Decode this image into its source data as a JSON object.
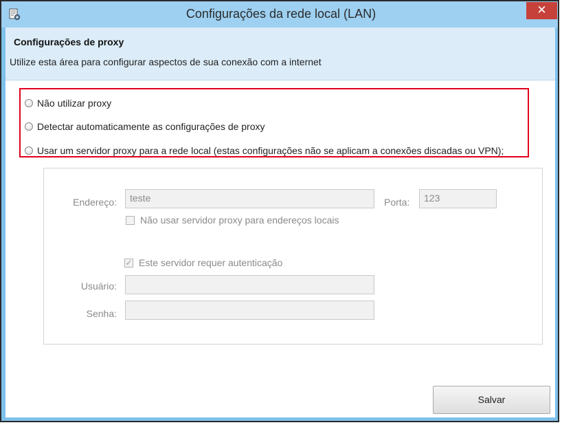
{
  "window": {
    "title": "Configurações da rede local (LAN)",
    "close_glyph": "✕",
    "app_icon": "settings-document-icon"
  },
  "header": {
    "title": "Configurações de proxy",
    "description": "Utilize esta área para configurar aspectos de sua conexão com a internet"
  },
  "proxy_options": [
    {
      "label": "Não utilizar proxy",
      "selected": false
    },
    {
      "label": "Detectar automaticamente as configurações de proxy",
      "selected": false
    },
    {
      "label": "Usar um servidor proxy para a rede local (estas configurações não se aplicam a conexões discadas ou VPN);",
      "selected": false
    }
  ],
  "proxy_settings": {
    "address_label": "Endereço:",
    "address_value": "teste",
    "port_label": "Porta:",
    "port_value": "123",
    "bypass_local_label": "Não usar servidor proxy para endereços locais",
    "bypass_local_checked": false,
    "auth_required_label": "Este servidor requer autenticação",
    "auth_required_checked": true,
    "user_label": "Usuário:",
    "user_value": "",
    "password_label": "Senha:",
    "password_value": "",
    "check_glyph": "✓"
  },
  "footer": {
    "save_label": "Salvar"
  },
  "colors": {
    "highlight_border": "#e0001b",
    "close_button": "#c7413b",
    "header_band": "#dcedf9",
    "disabled_text": "#8a8a8a"
  }
}
